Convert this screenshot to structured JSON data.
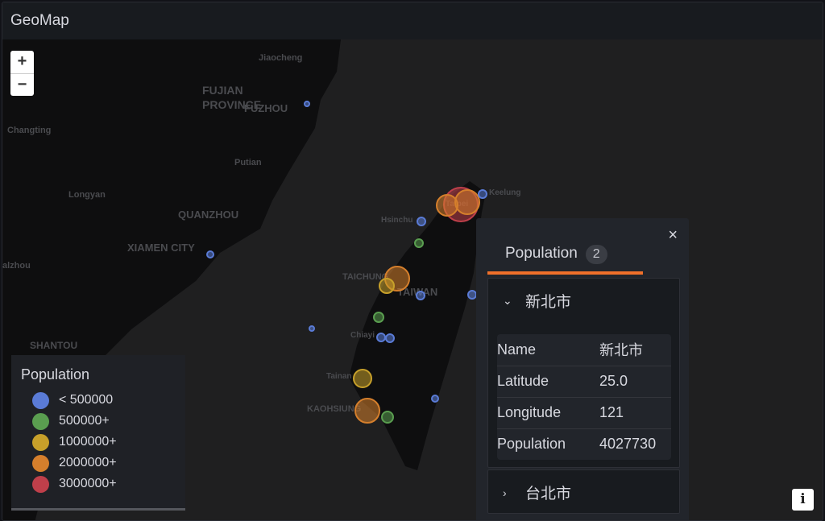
{
  "header": {
    "title": "GeoMap"
  },
  "zoom": {
    "in": "+",
    "out": "−"
  },
  "map_labels": [
    "Jiaocheng",
    "FUJIAN",
    "PROVINCE",
    "FUZHOU",
    "Changting",
    "Putian",
    "Longyan",
    "QUANZHOU",
    "XIAMEN CITY",
    "alzhou",
    "SHANTOU",
    "Hsinchu",
    "Keelung",
    "Taipei",
    "TAICHUNG",
    "TAIWAN",
    "Chiayi",
    "Tainan",
    "KAOHSIUNG"
  ],
  "legend": {
    "title": "Population",
    "items": [
      {
        "label": "< 500000",
        "color": "#5a7bd6"
      },
      {
        "label": "500000+",
        "color": "#5a9e50"
      },
      {
        "label": "1000000+",
        "color": "#c7a02a"
      },
      {
        "label": "2000000+",
        "color": "#d57f2c"
      },
      {
        "label": "3000000+",
        "color": "#bf3f4a"
      }
    ]
  },
  "markers": [
    {
      "class": 0
    },
    {
      "class": 0
    },
    {
      "class": 0
    },
    {
      "class": 4
    },
    {
      "class": 3
    },
    {
      "class": 3
    },
    {
      "class": 0
    },
    {
      "class": 0
    },
    {
      "class": 1
    },
    {
      "class": 3
    },
    {
      "class": 2
    },
    {
      "class": 0
    },
    {
      "class": 0
    },
    {
      "class": 1
    },
    {
      "class": 0
    },
    {
      "class": 0
    },
    {
      "class": 2
    },
    {
      "class": 3
    },
    {
      "class": 1
    },
    {
      "class": 0
    }
  ],
  "popup": {
    "close": "×",
    "tab": "Population",
    "count": "2",
    "accent": "#f0702a",
    "items": [
      {
        "name": "新北市",
        "expanded": true,
        "chevron": "chevron-down",
        "rows": [
          {
            "k": "Name",
            "v": "新北市"
          },
          {
            "k": "Latitude",
            "v": "25.0"
          },
          {
            "k": "Longitude",
            "v": "121"
          },
          {
            "k": "Population",
            "v": "4027730"
          }
        ]
      },
      {
        "name": "台北市",
        "expanded": false,
        "chevron": "chevron-right"
      }
    ]
  },
  "info": "i"
}
